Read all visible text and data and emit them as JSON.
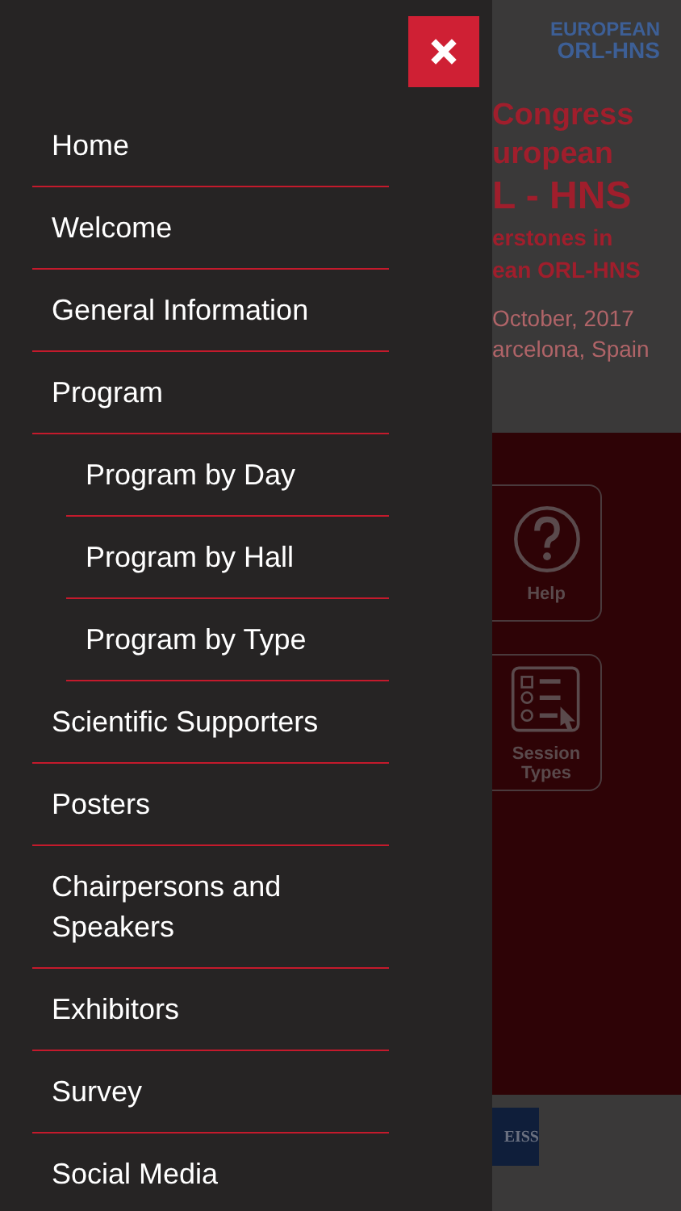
{
  "menu": {
    "items": [
      {
        "label": "Home"
      },
      {
        "label": "Welcome"
      },
      {
        "label": "General Information"
      },
      {
        "label": "Program",
        "children": [
          {
            "label": "Program by Day"
          },
          {
            "label": "Program by Hall"
          },
          {
            "label": "Program by Type"
          }
        ]
      },
      {
        "label": "Scientific Supporters"
      },
      {
        "label": "Posters"
      },
      {
        "label": "Chairpersons and Speakers"
      },
      {
        "label": "Exhibitors"
      },
      {
        "label": "Survey"
      },
      {
        "label": "Social Media"
      }
    ]
  },
  "background": {
    "logo": [
      "EUROPEAN",
      "ORL-HNS"
    ],
    "title_lines": [
      "Congress",
      "uropean",
      "L - HNS"
    ],
    "subtitle_lines": [
      "erstones in",
      "ean ORL-HNS"
    ],
    "date_lines": [
      "October, 2017",
      "arcelona, Spain"
    ],
    "tiles": [
      {
        "kind": "help",
        "label": "Help"
      },
      {
        "kind": "list",
        "label": "Session Types"
      }
    ],
    "sponsor": "EISS"
  }
}
